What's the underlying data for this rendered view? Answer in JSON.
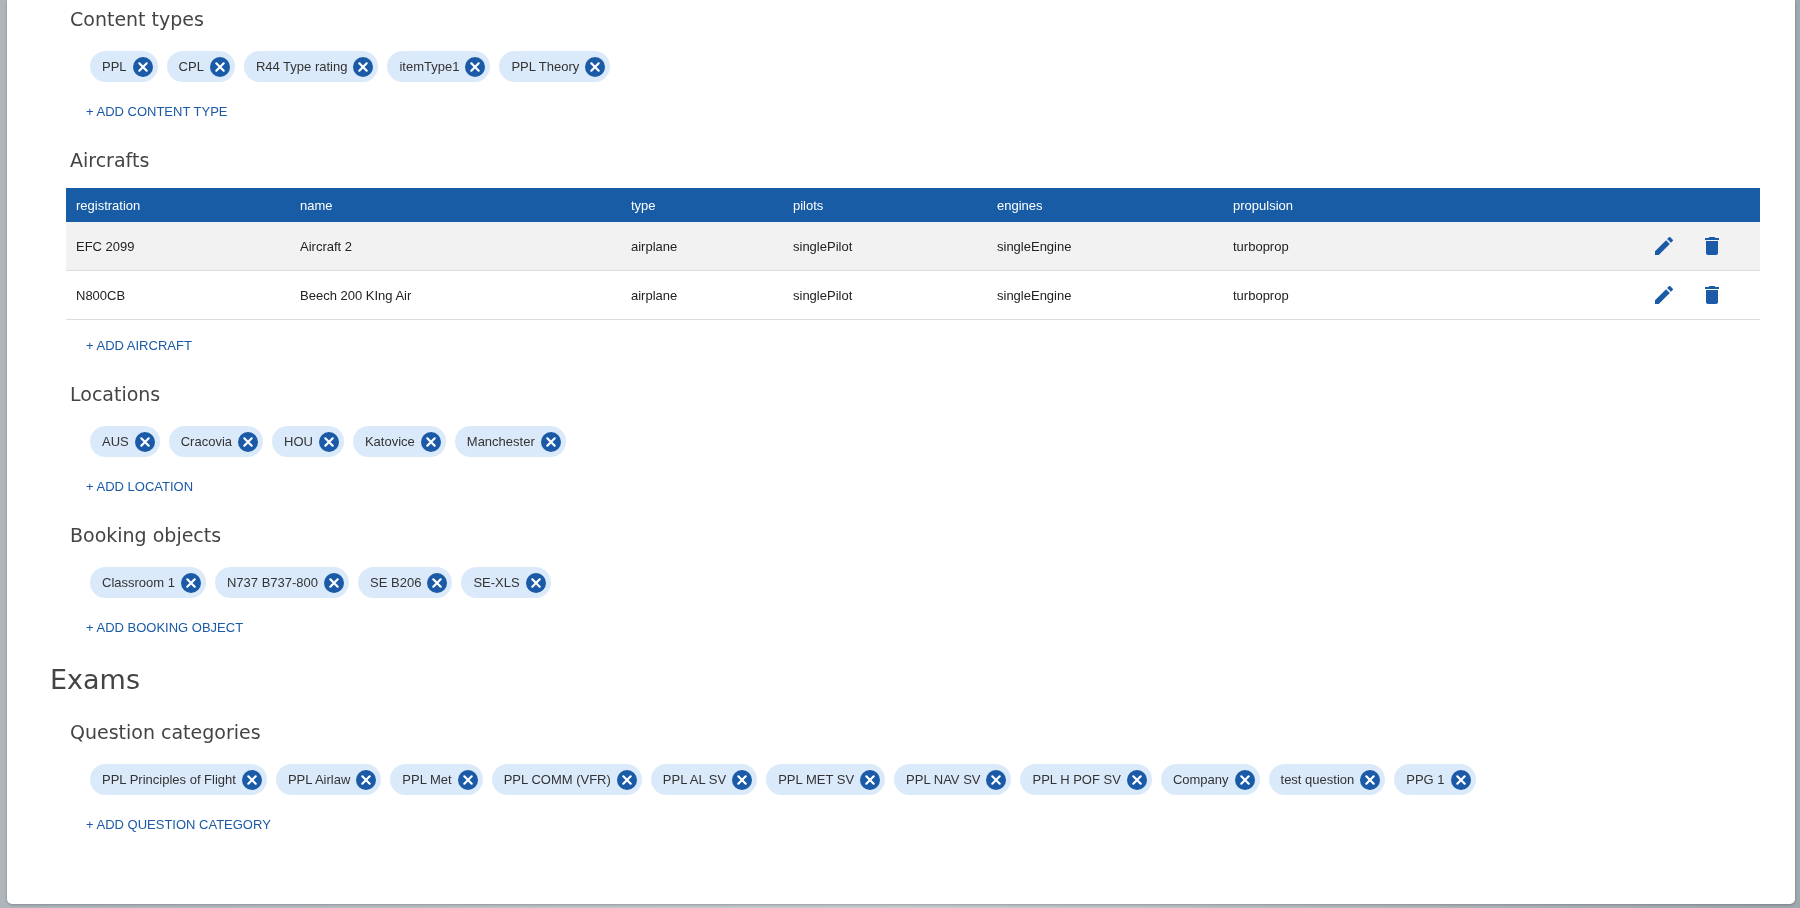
{
  "groups": [
    {
      "sections": [
        {
          "kind": "chips",
          "title": "Content types",
          "chips": [
            "PPL",
            "CPL",
            "R44 Type rating",
            "itemType1",
            "PPL Theory"
          ],
          "add_label": "+ ADD CONTENT TYPE"
        },
        {
          "kind": "table",
          "title": "Aircrafts",
          "columns": [
            "registration",
            "name",
            "type",
            "pilots",
            "engines",
            "propulsion"
          ],
          "rows": [
            {
              "cells": [
                "EFC 2099",
                "Aircraft 2",
                "airplane",
                "singlePilot",
                "singleEngine",
                "turboprop"
              ]
            },
            {
              "cells": [
                "N800CB",
                "Beech 200 KIng Air",
                "airplane",
                "singlePilot",
                "singleEngine",
                "turboprop"
              ]
            }
          ],
          "add_label": "+ ADD AIRCRAFT"
        },
        {
          "kind": "chips",
          "title": "Locations",
          "chips": [
            "AUS",
            "Cracovia",
            "HOU",
            "Katovice",
            "Manchester"
          ],
          "add_label": "+ ADD LOCATION"
        },
        {
          "kind": "chips",
          "title": "Booking objects",
          "chips": [
            "Classroom 1",
            "N737 B737-800",
            "SE B206",
            "SE-XLS"
          ],
          "add_label": "+ ADD BOOKING OBJECT"
        }
      ]
    },
    {
      "title": "Exams",
      "sections": [
        {
          "kind": "chips",
          "title": "Question categories",
          "chips": [
            "PPL Principles of Flight",
            "PPL Airlaw",
            "PPL Met",
            "PPL COMM (VFR)",
            "PPL AL SV",
            "PPL MET SV",
            "PPL NAV SV",
            "PPL H POF SV",
            "Company",
            "test question",
            "PPG 1"
          ],
          "add_label": "+ ADD QUESTION CATEGORY"
        }
      ]
    }
  ]
}
